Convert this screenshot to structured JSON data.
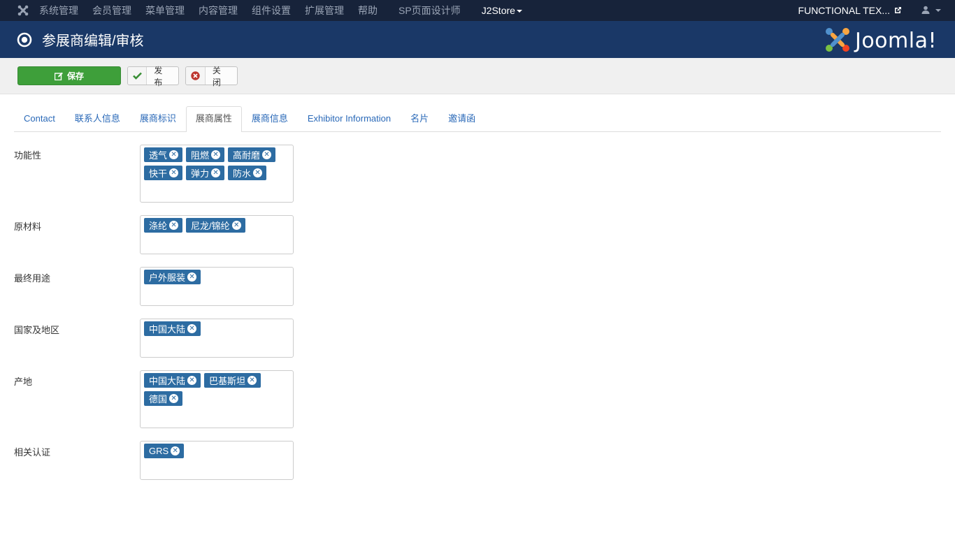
{
  "topnav": {
    "menu": [
      "系统管理",
      "会员管理",
      "菜单管理",
      "内容管理",
      "组件设置",
      "扩展管理",
      "帮助"
    ],
    "sp_designer": "SP页面设计师",
    "j2store": "J2Store",
    "site_name": "FUNCTIONAL TEX..."
  },
  "header": {
    "title": "参展商编辑/审核",
    "brand": "Joomla!"
  },
  "toolbar": {
    "save": "保存",
    "publish": "发布",
    "close": "关闭"
  },
  "tabs": [
    "Contact",
    "联系人信息",
    "展商标识",
    "展商属性",
    "展商信息",
    "Exhibitor Information",
    "名片",
    "邀请函"
  ],
  "active_tab": "展商属性",
  "fields": [
    {
      "label": "功能性",
      "tags": [
        "透气",
        "阻燃",
        "高耐磨",
        "快干",
        "弹力",
        "防水"
      ]
    },
    {
      "label": "原材料",
      "tags": [
        "涤纶",
        "尼龙/锦纶"
      ]
    },
    {
      "label": "最终用途",
      "tags": [
        "户外服装"
      ]
    },
    {
      "label": "国家及地区",
      "tags": [
        "中国大陆"
      ]
    },
    {
      "label": "产地",
      "tags": [
        "中国大陆",
        "巴基斯坦",
        "德国"
      ]
    },
    {
      "label": "相关认证",
      "tags": [
        "GRS"
      ]
    }
  ],
  "colors": {
    "topnav_bg": "#17233a",
    "header_bg": "#1a3867",
    "save_green": "#3e9f3a",
    "tag_blue": "#2d6ca2",
    "link_blue": "#2a69b8"
  }
}
